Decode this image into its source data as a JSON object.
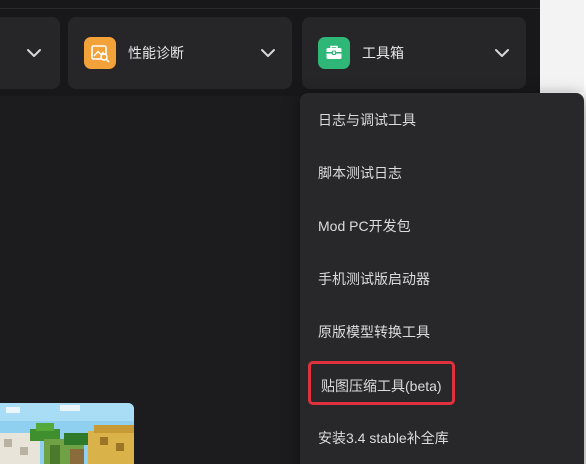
{
  "header": {
    "cards": [
      {
        "label": ""
      },
      {
        "label": "性能诊断",
        "icon": "image-search-icon",
        "icon_color": "#f3a23a"
      },
      {
        "label": "工具箱",
        "icon": "toolbox-icon",
        "icon_color": "#2fb778"
      }
    ]
  },
  "toolbox_menu": {
    "items": [
      {
        "label": "日志与调试工具"
      },
      {
        "label": "脚本测试日志"
      },
      {
        "label": "Mod PC开发包"
      },
      {
        "label": "手机测试版启动器"
      },
      {
        "label": "原版模型转换工具"
      },
      {
        "label": "贴图压缩工具(beta)",
        "highlight_color": "#e0313e"
      },
      {
        "label": "安装3.4 stable补全库"
      }
    ]
  },
  "colors": {
    "background": "#1c1c1e",
    "card": "#262629",
    "menu": "#28282b"
  }
}
